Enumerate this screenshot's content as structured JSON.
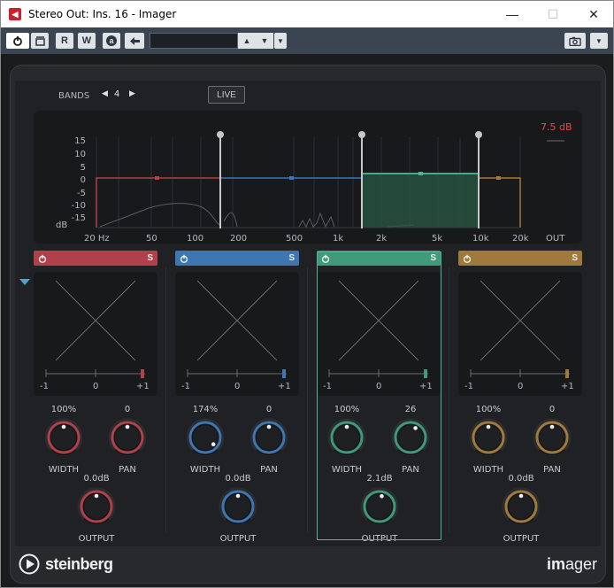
{
  "window": {
    "title": "Stereo Out: Ins. 16 - Imager",
    "minimize": "—",
    "maximize": "☐",
    "close": "✕"
  },
  "toolbar": {
    "power_icon": "power-icon",
    "bypass_icon": "bypass-icon",
    "read_label": "R",
    "write_label": "W",
    "a_label": "a",
    "preset_value": "",
    "camera_icon": "camera-icon"
  },
  "header": {
    "bands_label": "BANDS",
    "bands_value": "4",
    "live_label": "LIVE",
    "out_value": "7.5 dB"
  },
  "spectrum": {
    "y_ticks": [
      "15",
      "10",
      "5",
      "0",
      "-5",
      "-10",
      "-15"
    ],
    "y_unit": "dB",
    "x_ticks": [
      "20 Hz",
      "50",
      "100",
      "200",
      "500",
      "1k",
      "2k",
      "5k",
      "10k",
      "20k",
      "OUT"
    ]
  },
  "bands": [
    {
      "color": "#b0404a",
      "xy_axis": [
        "-1",
        "0",
        "+1"
      ],
      "width_value": "100%",
      "width_label": "WIDTH",
      "pan_value": "0",
      "pan_label": "PAN",
      "output_value": "0.0dB",
      "output_label": "OUTPUT",
      "solo_label": "S"
    },
    {
      "color": "#3d76b0",
      "xy_axis": [
        "-1",
        "0",
        "+1"
      ],
      "width_value": "174%",
      "width_label": "WIDTH",
      "pan_value": "0",
      "pan_label": "PAN",
      "output_value": "0.0dB",
      "output_label": "OUTPUT",
      "solo_label": "S"
    },
    {
      "color": "#3f9a7a",
      "xy_axis": [
        "-1",
        "0",
        "+1"
      ],
      "width_value": "100%",
      "width_label": "WIDTH",
      "pan_value": "26",
      "pan_label": "PAN",
      "output_value": "2.1dB",
      "output_label": "OUTPUT",
      "solo_label": "S"
    },
    {
      "color": "#a07a3c",
      "xy_axis": [
        "-1",
        "0",
        "+1"
      ],
      "width_value": "100%",
      "width_label": "WIDTH",
      "pan_value": "0",
      "pan_label": "PAN",
      "output_value": "0.0dB",
      "output_label": "OUTPUT",
      "solo_label": "S"
    }
  ],
  "footer": {
    "brand": "steinberg",
    "product_bold": "im",
    "product_rest": "ager"
  }
}
